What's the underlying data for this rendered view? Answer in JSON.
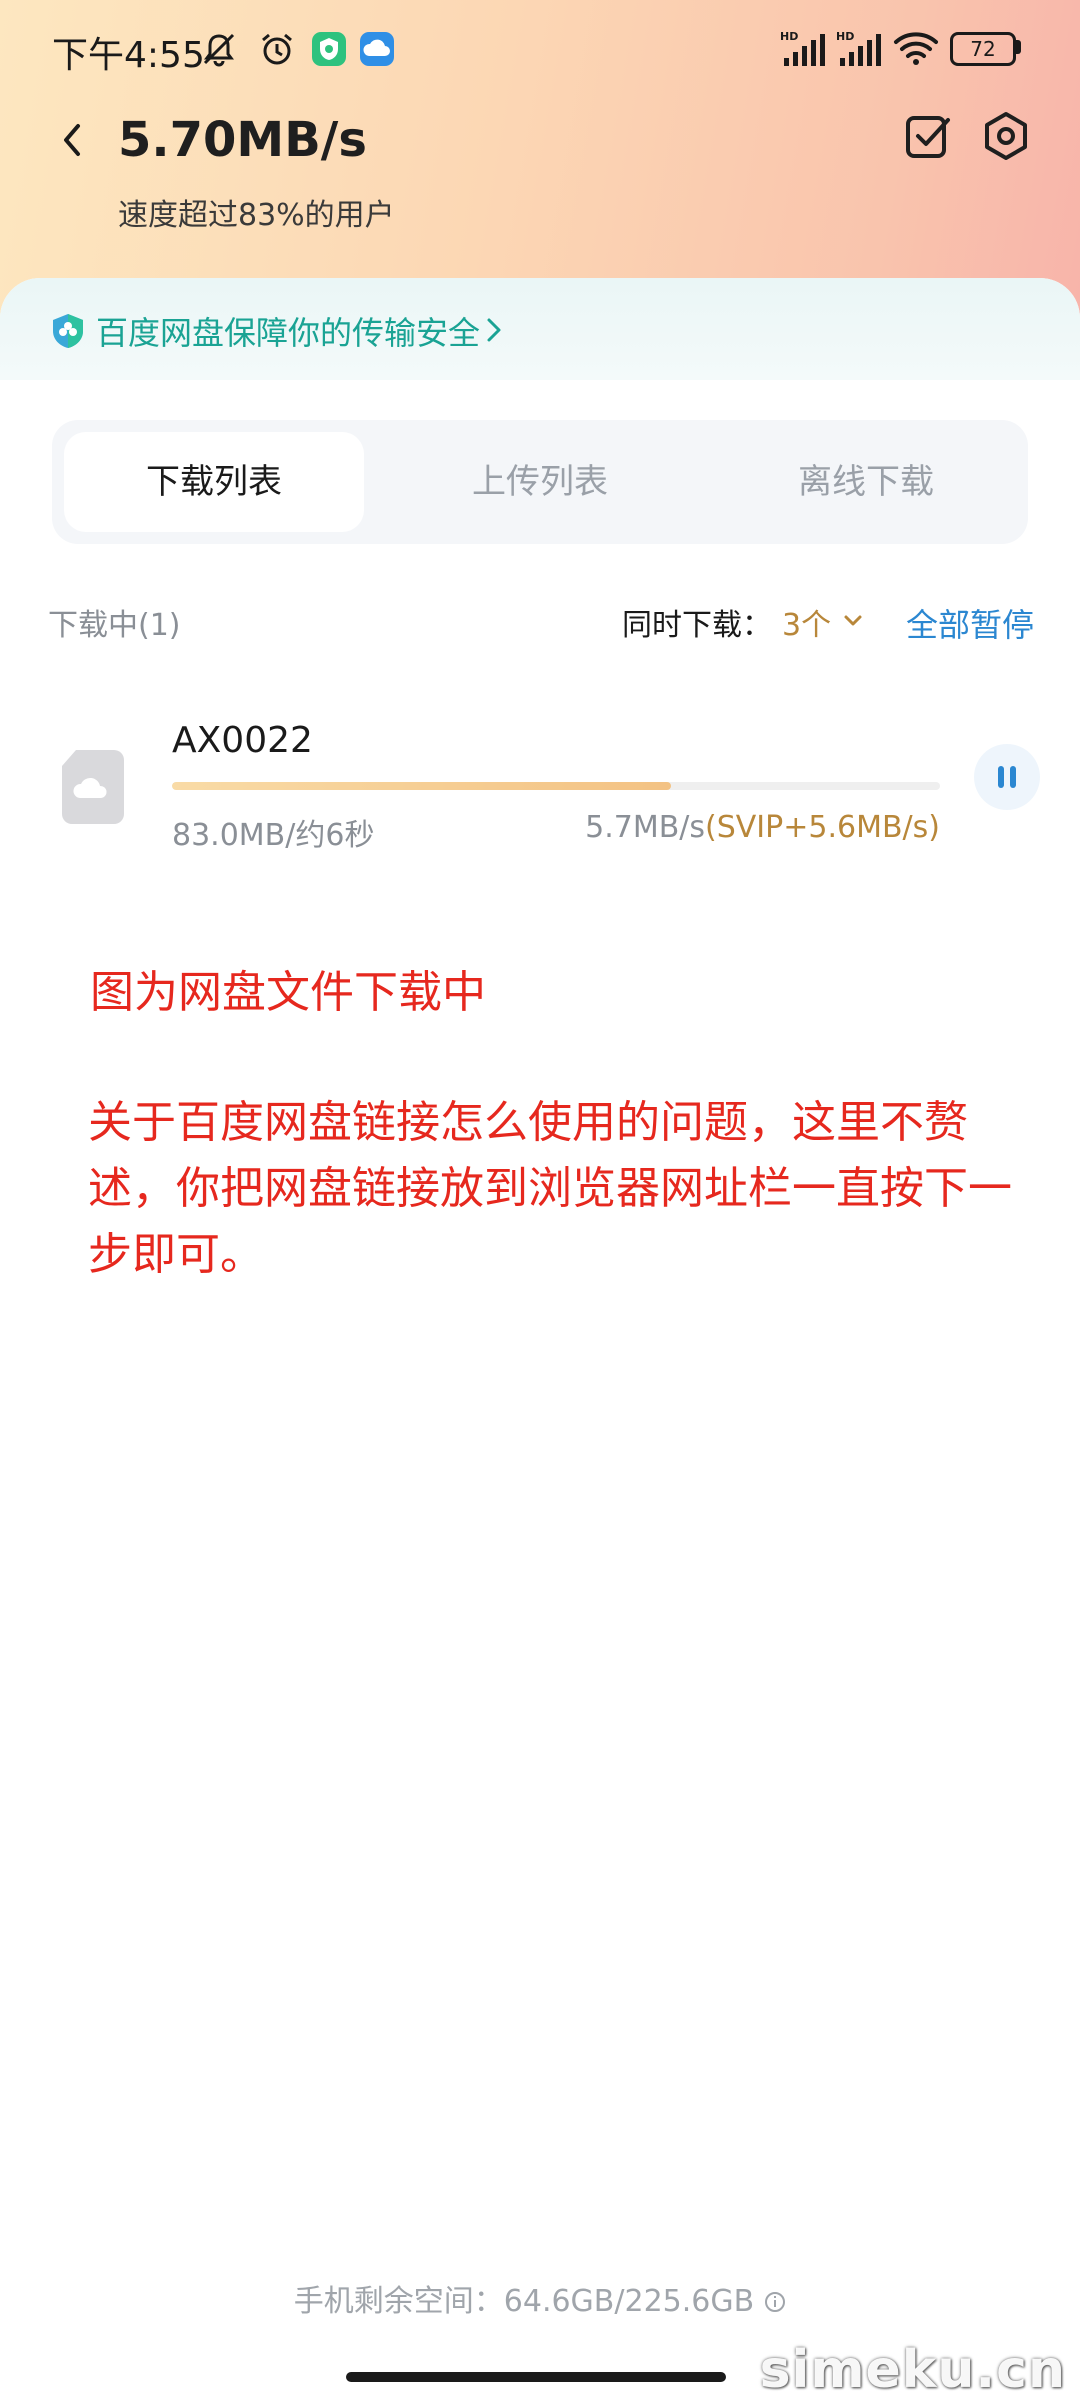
{
  "status_bar": {
    "time": "下午4:55",
    "battery": "72"
  },
  "header": {
    "speed": "5.70MB/s",
    "subtitle": "速度超过83%的用户"
  },
  "security_banner": {
    "text": "百度网盘保障你的传输安全"
  },
  "tabs": [
    {
      "label": "下载列表",
      "active": true
    },
    {
      "label": "上传列表",
      "active": false
    },
    {
      "label": "离线下载",
      "active": false
    }
  ],
  "list_header": {
    "downloading_label": "下载中(1)",
    "concurrent_label": "同时下载：",
    "concurrent_value": "3个",
    "pause_all_label": "全部暂停"
  },
  "download_item": {
    "name": "AX0022",
    "progress_text": "83.0MB/约6秒",
    "speed": "5.7MB/s",
    "svip_speed": "(SVIP+5.6MB/s)",
    "progress": 0.65
  },
  "annotation": {
    "line1": "图为网盘文件下载中",
    "line2": "关于百度网盘链接怎么使用的问题，这里不赘述，你把网盘链接放到浏览器网址栏一直按下一步即可。"
  },
  "footer": {
    "storage": "手机剩余空间：64.6GB/225.6GB"
  },
  "watermark": "simeku.cn",
  "colors": {
    "accent_gold": "#b8873a",
    "link_blue": "#2b87d1",
    "security_teal": "#1aa394",
    "annotation_red": "#e6281e"
  }
}
